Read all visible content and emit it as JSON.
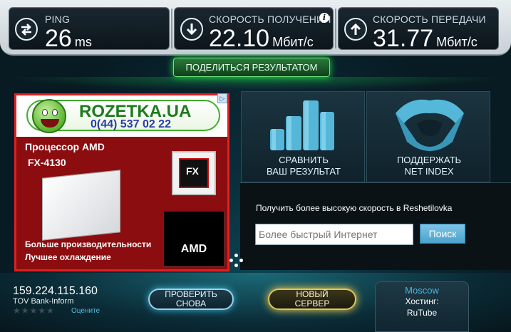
{
  "stats": {
    "ping": {
      "label": "PING",
      "value": "26",
      "unit": "ms",
      "icon": "ping-arrows-icon"
    },
    "download": {
      "label": "СКОРОСТЬ ПОЛУЧЕНИЯ",
      "value": "22.10",
      "unit": "Мбит/с",
      "icon": "download-arrow-icon"
    },
    "upload": {
      "label": "СКОРОСТЬ ПЕРЕДАЧИ",
      "value": "31.77",
      "unit": "Мбит/с",
      "icon": "upload-arrow-icon"
    }
  },
  "info_icon": "i",
  "share_label": "ПОДЕЛИТЬСЯ РЕЗУЛЬТАТОМ",
  "ad": {
    "brand": "ROZETKA.UA",
    "phone": "0(44) 537 02 22",
    "line1": "Процессор AMD",
    "line2": "FX-4130",
    "bottom1": "Больше производительности",
    "bottom2": "Лучшее охлаждение",
    "chip_text": "FX",
    "logo": "AMD",
    "adchoices": "▷"
  },
  "tiles": {
    "compare": {
      "line1": "СРАВНИТЬ",
      "line2": "ВАШ РЕЗУЛЬТАТ"
    },
    "support": {
      "line1": "ПОДДЕРЖАТЬ",
      "line2": "NET INDEX"
    }
  },
  "faster": {
    "label": "Получить более высокую скорость в Reshetilovka",
    "placeholder": "Более быстрый Интернет",
    "button": "Поиск"
  },
  "bottom": {
    "ip": "159.224.115.160",
    "isp": "TOV Bank-Inform",
    "stars": "★★★★★",
    "rate_label": "Оцените",
    "retest_line1": "ПРОВЕРИТЬ",
    "retest_line2": "СНОВА",
    "newserver_line1": "НОВЫЙ",
    "newserver_line2": "СЕРВЕР",
    "server_city": "Moscow",
    "host_label": "Хостинг:",
    "host_name": "RuTube"
  },
  "colors": {
    "accent_green": "#1fe04a",
    "accent_blue": "#47b8e0",
    "ad_red": "#e02020"
  }
}
